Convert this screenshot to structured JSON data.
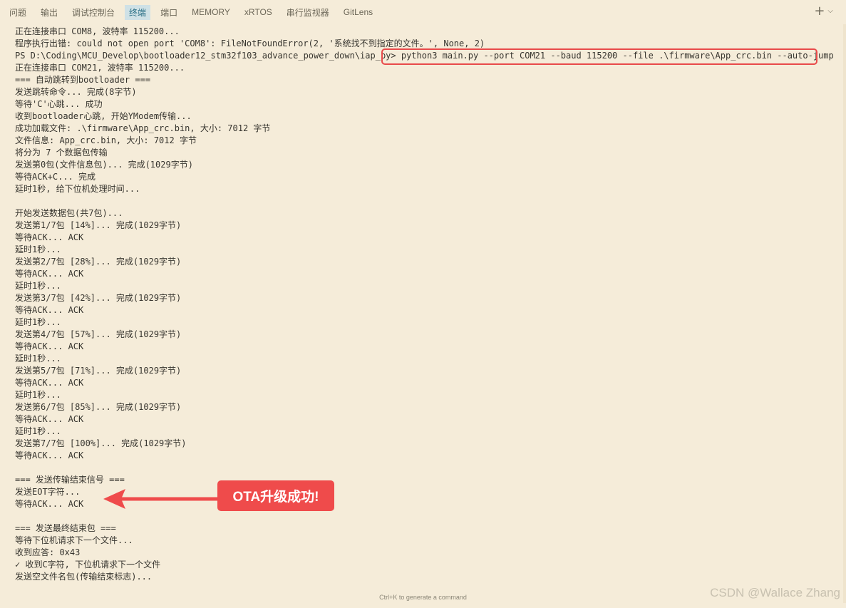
{
  "panel": {
    "tabs": [
      {
        "label": "问题",
        "active": false
      },
      {
        "label": "输出",
        "active": false
      },
      {
        "label": "调试控制台",
        "active": false
      },
      {
        "label": "终端",
        "active": true
      },
      {
        "label": "端口",
        "active": false
      },
      {
        "label": "MEMORY",
        "active": false
      },
      {
        "label": "xRTOS",
        "active": false
      },
      {
        "label": "串行监视器",
        "active": false
      },
      {
        "label": "GitLens",
        "active": false
      }
    ],
    "new_terminal_icon": "plus-icon",
    "dropdown_icon": "chevron-down-icon"
  },
  "terminal": {
    "lines": [
      "正在连接串口 COM8, 波特率 115200...",
      "程序执行出错: could not open port 'COM8': FileNotFoundError(2, '系统找不到指定的文件。', None, 2)",
      "PS D:\\Coding\\MCU_Develop\\bootloader12_stm32f103_advance_power_down\\iap_py> python3 main.py --port COM21 --baud 115200 --file .\\firmware\\App_crc.bin --auto-jump",
      "正在连接串口 COM21, 波特率 115200...",
      "=== 自动跳转到bootloader ===",
      "发送跳转命令... 完成(8字节)",
      "等待'C'心跳... 成功",
      "收到bootloader心跳, 开始YModem传输...",
      "成功加载文件: .\\firmware\\App_crc.bin, 大小: 7012 字节",
      "文件信息: App_crc.bin, 大小: 7012 字节",
      "将分为 7 个数据包传输",
      "发送第0包(文件信息包)... 完成(1029字节)",
      "等待ACK+C... 完成",
      "延时1秒, 给下位机处理时间...",
      "",
      "开始发送数据包(共7包)...",
      "发送第1/7包 [14%]... 完成(1029字节)",
      "等待ACK... ACK",
      "延时1秒...",
      "发送第2/7包 [28%]... 完成(1029字节)",
      "等待ACK... ACK",
      "延时1秒...",
      "发送第3/7包 [42%]... 完成(1029字节)",
      "等待ACK... ACK",
      "延时1秒...",
      "发送第4/7包 [57%]... 完成(1029字节)",
      "等待ACK... ACK",
      "延时1秒...",
      "发送第5/7包 [71%]... 完成(1029字节)",
      "等待ACK... ACK",
      "延时1秒...",
      "发送第6/7包 [85%]... 完成(1029字节)",
      "等待ACK... ACK",
      "延时1秒...",
      "发送第7/7包 [100%]... 完成(1029字节)",
      "等待ACK... ACK",
      "",
      "=== 发送传输结束信号 ===",
      "发送EOT字符...",
      "等待ACK... ACK",
      "",
      "=== 发送最终结束包 ===",
      "等待下位机请求下一个文件...",
      "收到应答: 0x43",
      "✓ 收到C字符, 下位机请求下一个文件",
      "发送空文件名包(传输结束标志)..."
    ]
  },
  "annotation": {
    "callout_text": "OTA升级成功!",
    "accent_color": "#ef4b4b"
  },
  "footer": {
    "hint": "Ctrl+K to generate a command",
    "watermark": "CSDN @Wallace Zhang"
  }
}
